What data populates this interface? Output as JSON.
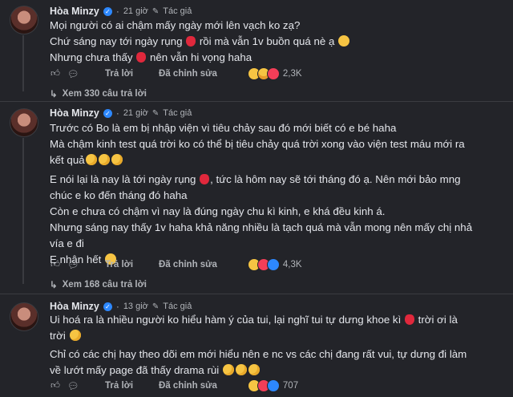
{
  "comments": [
    {
      "author": "Hòa Minzy",
      "time": "21 giờ",
      "badge": "Tác giả",
      "lines": [
        "Mọi người có ai chậm mấy ngày mới lên vạch ko zạ?",
        "Chứ sáng nay tới ngày rụng [strawberry] rồi mà vẫn 1v buồn quá nè ạ [sad]",
        "Nhưng chưa thấy [strawberry] nên vẫn hi vọng haha"
      ],
      "reply_label": "Trả lời",
      "edit_label": "Đã chỉnh sửa",
      "reaction_count": "2,3K",
      "more_replies": "Xem 330 câu trả lời"
    },
    {
      "author": "Hòa Minzy",
      "time": "21 giờ",
      "badge": "Tác giả",
      "lines": [
        "Trước có Bo là em bị nhập viện vì tiêu chảy sau đó mới biết có e bé haha",
        "Mà chậm kinh test quá trời ko có thể bị tiêu chảy quá trời xong vào viện test máu mới ra",
        "kết quả",
        "E nói lại là nay là tới ngày rụng , tức là hôm nay sẽ tới tháng đó ạ. Nên mới bảo mng",
        "chúc e ko đến tháng đó haha",
        "Còn e chưa có chậm vì nay là đúng ngày chu kì kinh, e khá đều kinh á.",
        "Nhưng sáng nay thấy 1v haha khả năng nhiều là tạch quá mà vẫn mong nên mấy chị nhả",
        "vía e đi",
        "E nhận hết"
      ],
      "reply_label": "Trả lời",
      "edit_label": "Đã chỉnh sửa",
      "reaction_count": "4,3K",
      "more_replies": "Xem 168 câu trả lời"
    },
    {
      "author": "Hòa Minzy",
      "time": "13 giờ",
      "badge": "Tác giả",
      "lines": [
        "Ui hoá ra là nhiều người ko hiểu hàm ý của tui, lại nghĩ tui tự dưng khoe kì  trời ơi là",
        "trời",
        "Chỉ có các chị hay theo dõi em mới hiểu nên e nc vs các chị đang rất vui, tự dưng đi làm",
        "về lướt mấy page đã thấy drama rùi"
      ],
      "reply_label": "Trả lời",
      "edit_label": "Đã chỉnh sửa",
      "reaction_count": "707"
    }
  ],
  "colors": {
    "background": "#232429",
    "text": "#e4e6eb",
    "muted": "#b0b3b8",
    "verified": "#2d88ff"
  }
}
